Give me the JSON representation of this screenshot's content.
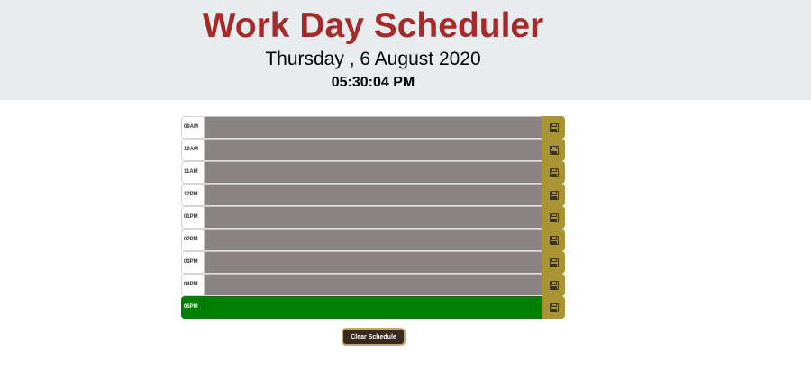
{
  "header": {
    "title": "Work Day Scheduler",
    "date": "Thursday , 6 August 2020",
    "time": "05:30:04 PM"
  },
  "schedule": {
    "rows": [
      {
        "hour": "09AM",
        "text": "",
        "status": "past"
      },
      {
        "hour": "10AM",
        "text": "",
        "status": "past"
      },
      {
        "hour": "11AM",
        "text": "",
        "status": "past"
      },
      {
        "hour": "12PM",
        "text": "",
        "status": "past"
      },
      {
        "hour": "01PM",
        "text": "",
        "status": "past"
      },
      {
        "hour": "02PM",
        "text": "",
        "status": "past"
      },
      {
        "hour": "03PM",
        "text": "",
        "status": "past"
      },
      {
        "hour": "04PM",
        "text": "",
        "status": "past"
      },
      {
        "hour": "05PM",
        "text": "",
        "status": "present"
      }
    ],
    "save_icon": "floppy-disk-icon"
  },
  "actions": {
    "clear_label": "Clear Schedule"
  },
  "colors": {
    "title": "#a52a2a",
    "header_bg": "#e9ecef",
    "past": "#898481",
    "present": "#008000",
    "save_button": "#aa9331",
    "clear_button": "#3a2a1e"
  }
}
